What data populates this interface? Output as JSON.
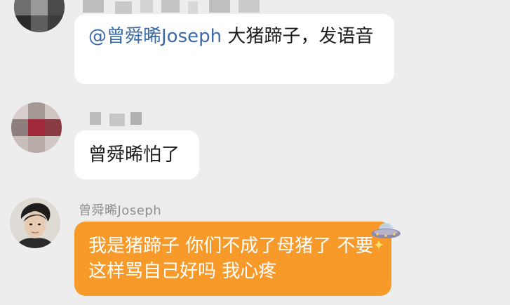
{
  "messages": [
    {
      "mention": "@曾舜晞Joseph",
      "text": " 大猪蹄子，发语音"
    },
    {
      "text": "曾舜晞怕了"
    },
    {
      "sender_name": "曾舜晞Joseph",
      "text": "我是猪蹄子 你们不成了母猪了 不要这样骂自己好吗 我心疼",
      "sticker": "ufo-sparkle-icon"
    }
  ],
  "colors": {
    "background": "#ededed",
    "bubble": "#ffffff",
    "highlight_bubble": "#f79a29",
    "mention": "#3c6aa6",
    "sender_name": "#8f8f8f"
  }
}
